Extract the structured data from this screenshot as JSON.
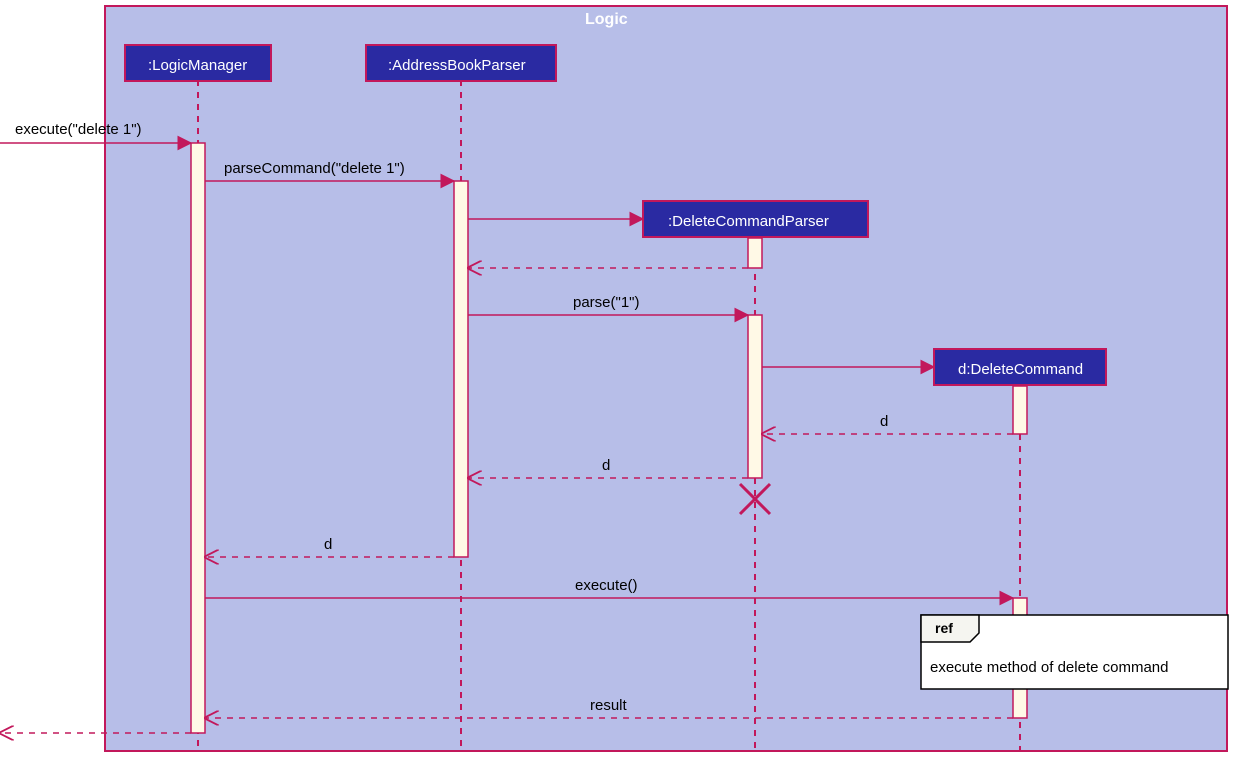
{
  "frame": {
    "title": "Logic"
  },
  "participants": {
    "logicManager": ":LogicManager",
    "addressBookParser": ":AddressBookParser",
    "deleteCommandParser": ":DeleteCommandParser",
    "deleteCommand": "d:DeleteCommand"
  },
  "messages": {
    "execute1": "execute(\"delete 1\")",
    "parseCommand": "parseCommand(\"delete 1\")",
    "parse": "parse(\"1\")",
    "returnD1": "d",
    "returnD2": "d",
    "returnD3": "d",
    "execute2": "execute()",
    "result": "result"
  },
  "ref": {
    "label": "ref",
    "text": "execute method of delete command"
  }
}
